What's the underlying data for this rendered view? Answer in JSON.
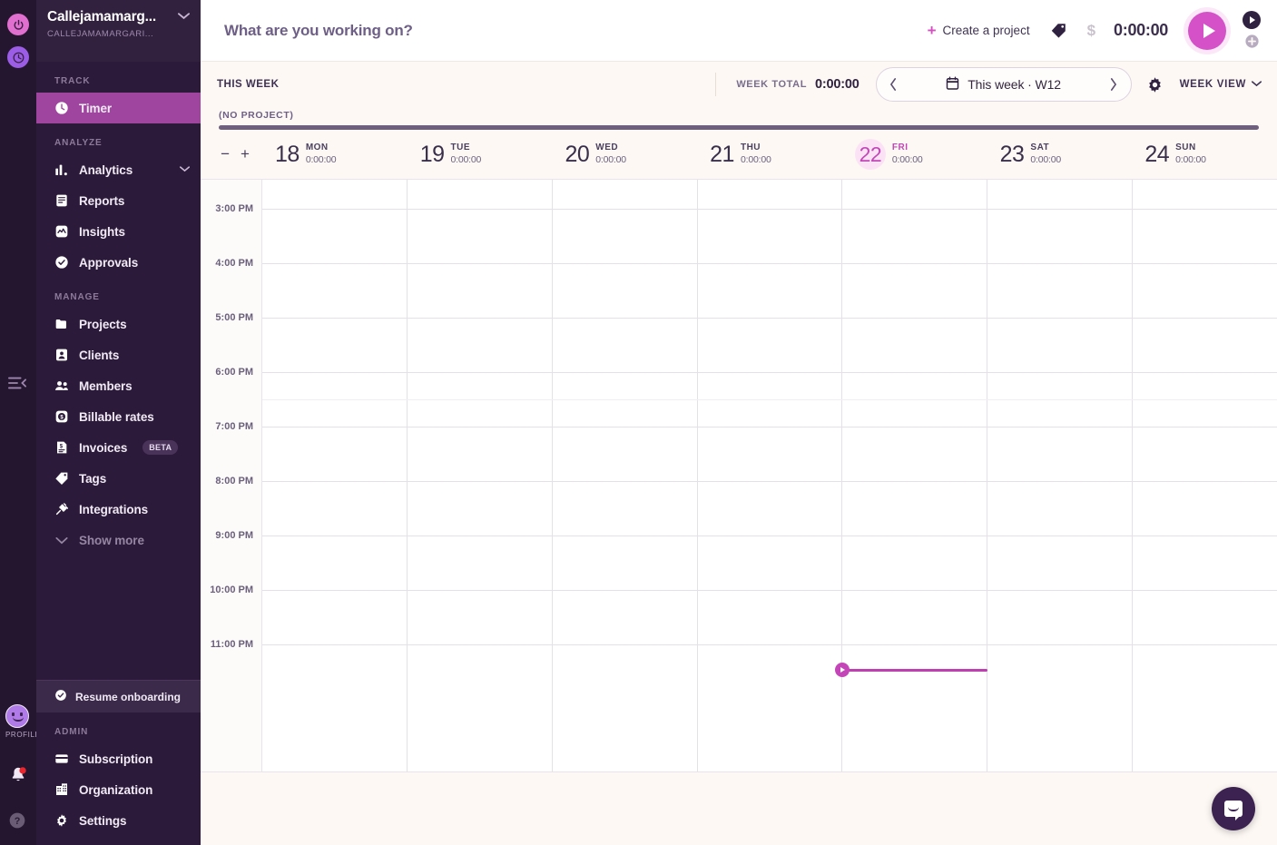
{
  "rail": {
    "power_icon": "power-icon",
    "clock_icon": "clock-icon",
    "collapse_icon": "collapse-sidebar-icon",
    "profile_label": "PROFILE",
    "bell_icon": "notification-bell-icon",
    "help_icon": "help-icon"
  },
  "sidebar": {
    "org_name": "Callejamamarg...",
    "org_sub": "CALLEJAMAMARGARI...",
    "sections": [
      {
        "label": "TRACK",
        "items": [
          {
            "label": "Timer",
            "icon": "clock-icon",
            "active": true
          }
        ]
      },
      {
        "label": "ANALYZE",
        "items": [
          {
            "label": "Analytics",
            "icon": "bar-chart-icon",
            "caret": "⌄"
          },
          {
            "label": "Reports",
            "icon": "report-icon"
          },
          {
            "label": "Insights",
            "icon": "insights-icon"
          },
          {
            "label": "Approvals",
            "icon": "check-circle-icon"
          }
        ]
      },
      {
        "label": "MANAGE",
        "items": [
          {
            "label": "Projects",
            "icon": "folder-icon"
          },
          {
            "label": "Clients",
            "icon": "person-card-icon"
          },
          {
            "label": "Members",
            "icon": "people-icon"
          },
          {
            "label": "Billable rates",
            "icon": "dollar-circle-icon"
          },
          {
            "label": "Invoices",
            "icon": "invoice-icon",
            "badge": "BETA"
          },
          {
            "label": "Tags",
            "icon": "tag-icon"
          },
          {
            "label": "Integrations",
            "icon": "plug-icon"
          },
          {
            "label": "Show more",
            "icon": "chevron-down-icon",
            "muted": true
          }
        ]
      }
    ],
    "onboarding": {
      "label": "Resume onboarding",
      "icon": "check-circle-icon"
    },
    "admin": {
      "label": "ADMIN",
      "items": [
        {
          "label": "Subscription",
          "icon": "credit-card-icon"
        },
        {
          "label": "Organization",
          "icon": "building-icon"
        },
        {
          "label": "Settings",
          "icon": "gear-icon"
        }
      ]
    }
  },
  "topbar": {
    "task_placeholder": "What are you working on?",
    "task_value": "",
    "create_project_label": "Create a project",
    "create_plus": "+",
    "tag_icon": "tag-icon",
    "billable_icon": "dollar-icon",
    "billable_symbol": "$",
    "timer_value": "0:00:00",
    "play_icon": "play-icon",
    "mode_timer_icon": "play-icon",
    "mode_manual_icon": "plus-circle-icon"
  },
  "subbar": {
    "this_week_label": "THIS WEEK",
    "week_total_label": "WEEK TOTAL",
    "week_total_value": "0:00:00",
    "prev_icon": "chevron-left-icon",
    "next_icon": "chevron-right-icon",
    "calendar_icon": "calendar-icon",
    "range_label": "This week · W12",
    "gear_icon": "gear-icon",
    "view_label": "WEEK VIEW",
    "view_caret": "⌄"
  },
  "project_bar": {
    "label": "(NO PROJECT)",
    "color": "#6f5f7e"
  },
  "calendar": {
    "zoom_out_icon": "zoom-out-icon",
    "zoom_in_icon": "zoom-in-icon",
    "zoom_out": "−",
    "zoom_in": "+",
    "days": [
      {
        "num": "18",
        "dow": "MON",
        "total": "0:00:00",
        "today": false
      },
      {
        "num": "19",
        "dow": "TUE",
        "total": "0:00:00",
        "today": false
      },
      {
        "num": "20",
        "dow": "WED",
        "total": "0:00:00",
        "today": false
      },
      {
        "num": "21",
        "dow": "THU",
        "total": "0:00:00",
        "today": false
      },
      {
        "num": "22",
        "dow": "FRI",
        "total": "0:00:00",
        "today": true
      },
      {
        "num": "23",
        "dow": "SAT",
        "total": "0:00:00",
        "today": false
      },
      {
        "num": "24",
        "dow": "SUN",
        "total": "0:00:00",
        "today": false
      }
    ],
    "hours": [
      "3:00 PM",
      "4:00 PM",
      "5:00 PM",
      "6:00 PM",
      "7:00 PM",
      "8:00 PM",
      "9:00 PM",
      "10:00 PM",
      "11:00 PM"
    ],
    "now_indicator": {
      "day_index": 4,
      "icon": "play-icon",
      "color": "#bd3fb0"
    }
  },
  "intercom": {
    "icon": "intercom-messenger-icon"
  },
  "colors": {
    "accent": "#d451c7",
    "sidebar_bg": "#2c1a3a",
    "sidebar_active": "#a0459f",
    "page_bg": "#fdf8f4",
    "today_pill": "#fbe3f5"
  }
}
